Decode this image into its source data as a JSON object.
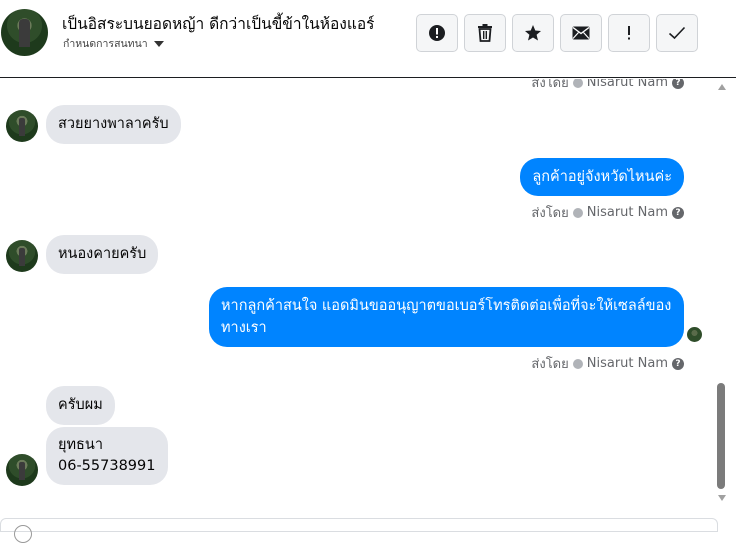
{
  "header": {
    "title": "เป็นอิสระบนยอดหญ้า ดีกว่าเป็นขี้ข้าในห้องแอร์",
    "subtitle": "กำหนดการสนทนา",
    "toolbar_icons": [
      "alert-circle-icon",
      "trash-icon",
      "star-icon",
      "mail-icon",
      "exclamation-icon",
      "check-icon"
    ]
  },
  "messages": {
    "sent_by_prefix": "ส่งโดย",
    "sent_by_name": "Nisarut Nam",
    "help_glyph": "?",
    "m1": "สวยยางพาลาครับ",
    "m2": "ลูกค้าอยู่จังหวัดไหนค่ะ",
    "m3": "หนองคายครับ",
    "m4": "หากลูกค้าสนใจ แอดมินขออนุญาตขอเบอร์โทรติดต่อเพื่อที่จะให้เซลล์ของทางเรา",
    "m5": "ครับผม",
    "m6_line1": "ยุทธนา",
    "m6_line2": "06-55738991"
  },
  "colors": {
    "outgoing_bubble": "#0084ff",
    "incoming_bubble": "#e4e6eb",
    "meta_text": "#65676b"
  }
}
